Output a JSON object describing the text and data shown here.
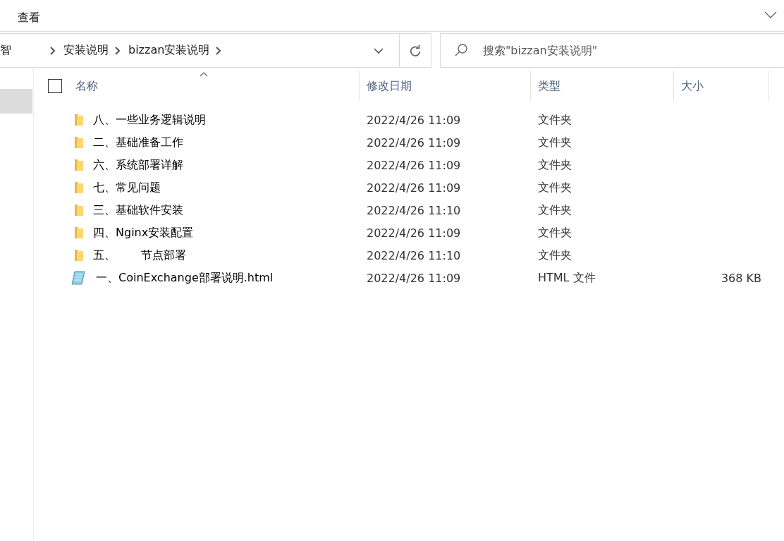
{
  "ribbon": {
    "tabs": [
      {
        "label": "查看",
        "selected": false
      }
    ]
  },
  "address_bar": {
    "crumbs": [
      "智",
      "安装说明",
      "bizzan安装说明"
    ]
  },
  "search": {
    "placeholder": "搜索\"bizzan安装说明\""
  },
  "table": {
    "select_all_checked": false,
    "columns": [
      {
        "label": "名称",
        "sorted": true
      },
      {
        "label": "修改日期",
        "sorted": false
      },
      {
        "label": "类型",
        "sorted": false
      },
      {
        "label": "大小",
        "sorted": false
      }
    ],
    "rows": [
      {
        "kind": "folder",
        "name_parts": [
          "八、一些业务逻辑说明"
        ],
        "date": "2022/4/26 11:09",
        "type": "文件夹"
      },
      {
        "kind": "folder",
        "name_parts": [
          "二、基础准备工作"
        ],
        "date": "2022/4/26 11:09",
        "type": "文件夹"
      },
      {
        "kind": "folder",
        "name_parts": [
          "六、系统部署详解"
        ],
        "date": "2022/4/26 11:09",
        "type": "文件夹"
      },
      {
        "kind": "folder",
        "name_parts": [
          "七、常见问题"
        ],
        "date": "2022/4/26 11:09",
        "type": "文件夹"
      },
      {
        "kind": "folder",
        "name_parts": [
          "三、基础软件安装"
        ],
        "date": "2022/4/26 11:10",
        "type": "文件夹"
      },
      {
        "kind": "folder",
        "name_parts": [
          "四、Nginx安装配置"
        ],
        "date": "2022/4/26 11:09",
        "type": "文件夹"
      },
      {
        "kind": "folder",
        "name_parts": [
          "五、",
          "节点部署"
        ],
        "date": "2022/4/26 11:10",
        "type": "文件夹"
      },
      {
        "kind": "html",
        "name_parts": [
          "一、CoinExchange部署说明.html"
        ],
        "date": "2022/4/26 11:09",
        "type": "HTML 文件",
        "size": "368 KB"
      }
    ]
  }
}
